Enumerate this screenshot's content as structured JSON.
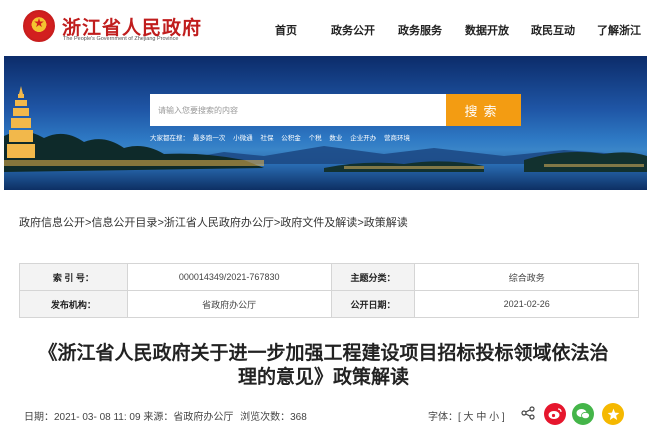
{
  "header": {
    "title": "浙江省人民政府",
    "subtitle": "The People's Government of Zhejiang Province",
    "nav": [
      "首页",
      "政务公开",
      "政务服务",
      "数据开放",
      "政民互动",
      "了解浙江"
    ]
  },
  "banner": {
    "search_placeholder": "请输入您要搜索的内容",
    "search_button": "搜索",
    "hot_prefix": "大家都在搜：",
    "hot_words": [
      "最多跑一次",
      "小微通",
      "社保",
      "公积金",
      "个税",
      "数业",
      "企业开办",
      "营商环境"
    ]
  },
  "breadcrumb": [
    "政府信息公开",
    "信息公开目录",
    "浙江省人民政府办公厅",
    "政府文件及解读",
    "政策解读"
  ],
  "info": {
    "index_label": "索 引 号：",
    "index_value": "000014349/2021-767830",
    "topic_label": "主题分类：",
    "topic_value": "综合政务",
    "org_label": "发布机构：",
    "org_value": "省政府办公厅",
    "date_label": "公开日期：",
    "date_value": "2021-02-26"
  },
  "doc": {
    "title_line1": "《浙江省人民政府关于进一步加强工程建设项目招标投标领域依法治",
    "title_line2": "理的意见》政策解读"
  },
  "meta": {
    "date_label": "日期：",
    "date_value": "2021- 03- 08 11: 09",
    "source_label": "来源：",
    "source_value": "省政府办公厅",
    "views_label": "浏览次数：",
    "views_value": "368",
    "font_label": "字体：",
    "font_options": "[ 大 中 小 ]"
  },
  "colors": {
    "brand_red": "#c01d1d",
    "search_orange": "#f39c12",
    "weibo": "#e6162d",
    "wechat": "#44b549",
    "star": "#f5b800"
  },
  "icons": [
    "national-emblem-icon",
    "share-icon",
    "weibo-icon",
    "wechat-icon",
    "favorite-star-icon"
  ]
}
